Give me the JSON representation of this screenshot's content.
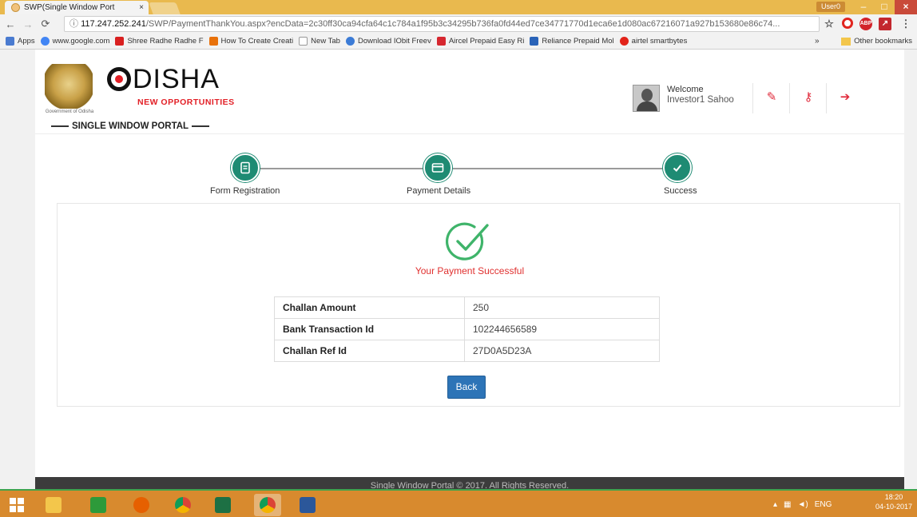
{
  "browser": {
    "tab_title": "SWP(Single Window Port",
    "tab_close": "×",
    "user_chip": "User0",
    "win_min": "–",
    "win_max": "□",
    "win_close": "×",
    "url_host": "117.247.252.241",
    "url_path": "/SWP/PaymentThankYou.aspx?encData=2c30ff30ca94cfa64c1c784a1f95b3c34295b736fa0fd44ed7ce34771770d1eca6e1d080ac67216071a927b153680e86c74...",
    "bookmarks": [
      {
        "label": "Apps",
        "color": "#4a7bd0"
      },
      {
        "label": "www.google.com",
        "color": "#4285f4"
      },
      {
        "label": "Shree Radhe Radhe F",
        "color": "#d92020"
      },
      {
        "label": "How To Create Creati",
        "color": "#e8710a"
      },
      {
        "label": "New Tab",
        "color": "#cccccc"
      },
      {
        "label": "Download IObit Freev",
        "color": "#3b7bd6"
      },
      {
        "label": "Aircel Prepaid Easy Ri",
        "color": "#d6272f"
      },
      {
        "label": "Reliance Prepaid Mol",
        "color": "#2a63b8"
      },
      {
        "label": "airtel smartbytes",
        "color": "#e2231a"
      }
    ],
    "bookmarks_more": "»",
    "other_bookmarks": "Other bookmarks"
  },
  "header": {
    "emblem_caption": "Government of Odisha",
    "logo_word": "DISHA",
    "logo_tagline": "NEW OPPORTUNITIES",
    "portal_name": "SINGLE WINDOW PORTAL",
    "welcome": "Welcome",
    "user_name": "Investor1 Sahoo"
  },
  "steps": [
    {
      "label": "Form Registration",
      "icon": "form-icon"
    },
    {
      "label": "Payment Details",
      "icon": "card-icon"
    },
    {
      "label": "Success",
      "icon": "check-icon"
    }
  ],
  "result": {
    "message": "Your Payment Successful",
    "rows": [
      {
        "key": "Challan Amount",
        "value": "250"
      },
      {
        "key": "Bank Transaction Id",
        "value": "102244656589"
      },
      {
        "key": "Challan Ref Id",
        "value": "27D0A5D23A"
      }
    ],
    "back_label": "Back"
  },
  "footer": "Single Window Portal © 2017. All Rights Reserved.",
  "taskbar": {
    "tray_lang": "ENG",
    "time": "18:20",
    "date": "04-10-2017"
  },
  "colors": {
    "accent_green": "#1e8b73",
    "error_red": "#e0302f",
    "button_blue": "#2d74b7"
  }
}
